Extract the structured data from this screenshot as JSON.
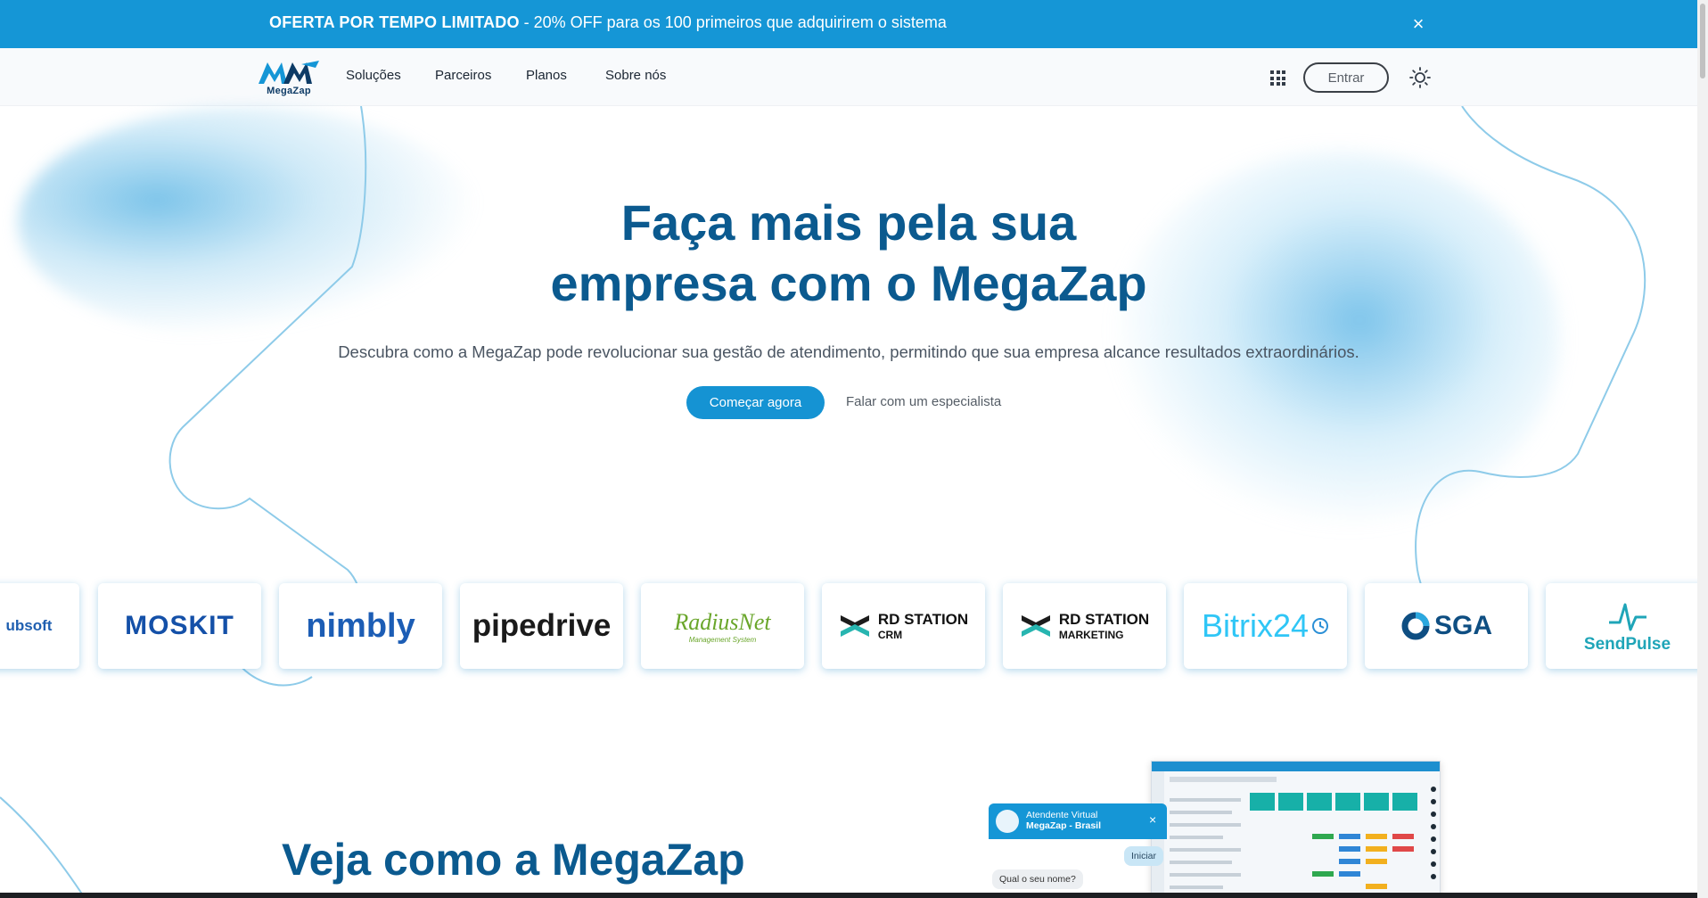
{
  "promo": {
    "bold": "OFERTA POR TEMPO LIMITADO",
    "rest": " - 20% OFF para os 100 primeiros que adquirirem o sistema",
    "close": "×"
  },
  "nav": {
    "logo_word": "MegaZap",
    "links": [
      "Soluções",
      "Parceiros",
      "Planos",
      "Sobre nós"
    ],
    "login": "Entrar"
  },
  "hero": {
    "title_line1": "Faça mais pela sua",
    "title_line2": "empresa com o MegaZap",
    "subtitle": "Descubra como a MegaZap pode revolucionar sua gestão de atendimento, permitindo que sua empresa alcance resultados extraordinários.",
    "cta_primary": "Começar agora",
    "cta_secondary": "Falar com um especialista"
  },
  "partners": [
    "ubsoft",
    "MOSKIT",
    "nimbly",
    "pipedrive",
    "RadiusNet",
    "RD STATION CRM",
    "RD STATION MARKETING",
    "Bitrix24",
    "SGA",
    "SendPulse"
  ],
  "partner_texts": {
    "radius_sub": "Management System",
    "rd_crm_1": "RD STATION",
    "rd_crm_2": "CRM",
    "rd_mkt_1": "RD STATION",
    "rd_mkt_2": "MARKETING"
  },
  "section": {
    "title": "Veja como a MegaZap"
  },
  "chat": {
    "name_line1": "Atendente Virtual",
    "name_line2": "MegaZap - Brasil",
    "close": "×",
    "iniciar": "Iniciar",
    "question": "Qual o seu nome?"
  },
  "colors": {
    "brand": "#1596d6",
    "heading": "#0b5a8f"
  }
}
